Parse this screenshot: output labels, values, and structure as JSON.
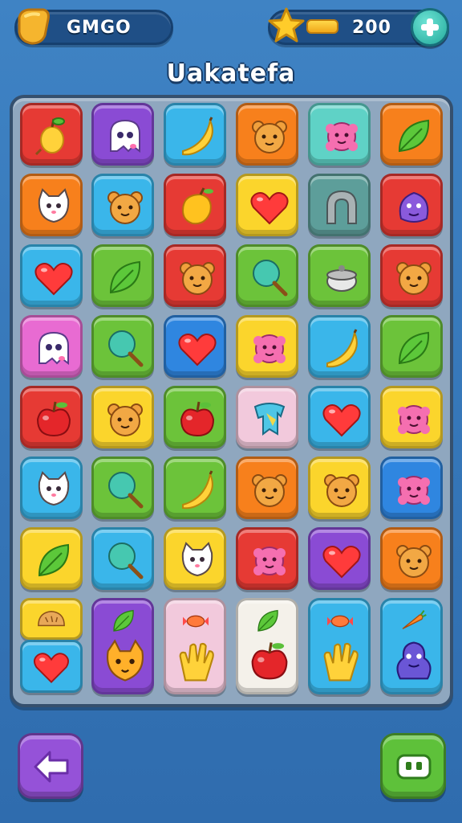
{
  "header": {
    "player_name": "GMGO",
    "coins": "200",
    "title": "Uakatefa"
  },
  "colors": {
    "red": "#e63a34",
    "purple": "#8a4bd4",
    "sky": "#3ab6ea",
    "orange": "#f7801c",
    "teal": "#5fd2c6",
    "yellow": "#fbd52c",
    "green": "#6cc33a",
    "blue": "#2f86e0",
    "pink": "#e86bd2",
    "pale": "#f2c9dc",
    "gray": "#5d9e9a"
  },
  "board": {
    "rows": [
      [
        {
          "color": "red",
          "icon": "pear"
        },
        {
          "color": "purple",
          "icon": "ghost"
        },
        {
          "color": "sky",
          "icon": "banana"
        },
        {
          "color": "orange",
          "icon": "bear"
        },
        {
          "color": "teal",
          "icon": "flower"
        },
        {
          "color": "orange",
          "icon": "leaf"
        }
      ],
      [
        {
          "color": "orange",
          "icon": "cat"
        },
        {
          "color": "sky",
          "icon": "bear"
        },
        {
          "color": "red",
          "icon": "mango"
        },
        {
          "color": "yellow",
          "icon": "heart"
        },
        {
          "color": "gray",
          "icon": "horseshoe"
        },
        {
          "color": "red",
          "icon": "blob"
        }
      ],
      [
        {
          "color": "sky",
          "icon": "heart"
        },
        {
          "color": "green",
          "icon": "leaf"
        },
        {
          "color": "red",
          "icon": "bear"
        },
        {
          "color": "green",
          "icon": "lollipop"
        },
        {
          "color": "green",
          "icon": "pot"
        },
        {
          "color": "red",
          "icon": "bear"
        }
      ],
      [
        {
          "color": "pink",
          "icon": "ghost"
        },
        {
          "color": "green",
          "icon": "lollipop"
        },
        {
          "color": "blue",
          "icon": "heart"
        },
        {
          "color": "yellow",
          "icon": "flower"
        },
        {
          "color": "sky",
          "icon": "banana"
        },
        {
          "color": "green",
          "icon": "leaf"
        }
      ],
      [
        {
          "color": "red",
          "icon": "apple"
        },
        {
          "color": "yellow",
          "icon": "bear"
        },
        {
          "color": "green",
          "icon": "apple"
        },
        {
          "color": "pale",
          "icon": "tooth"
        },
        {
          "color": "sky",
          "icon": "heart"
        },
        {
          "color": "yellow",
          "icon": "flower"
        }
      ],
      [
        {
          "color": "sky",
          "icon": "cat"
        },
        {
          "color": "green",
          "icon": "lollipop"
        },
        {
          "color": "green",
          "icon": "banana"
        },
        {
          "color": "orange",
          "icon": "bear"
        },
        {
          "color": "yellow",
          "icon": "bear"
        },
        {
          "color": "blue",
          "icon": "flower"
        }
      ],
      [
        {
          "color": "yellow",
          "icon": "leaf"
        },
        {
          "color": "sky",
          "icon": "lollipop"
        },
        {
          "color": "yellow",
          "icon": "cat"
        },
        {
          "color": "red",
          "icon": "flower"
        },
        {
          "color": "purple",
          "icon": "heart"
        },
        {
          "color": "orange",
          "icon": "bear"
        }
      ]
    ],
    "last_row": [
      {
        "top_color": "yellow",
        "top_icon": "bread",
        "color": "sky",
        "icon": "heart"
      },
      {
        "color": "purple",
        "top_icon": "leaf",
        "icon": "fox"
      },
      {
        "color": "pale",
        "top_icon": "candy",
        "icon": "hand"
      },
      {
        "color": "white",
        "top_icon": "leaf",
        "icon": "apple"
      },
      {
        "color": "sky",
        "top_icon": "candy",
        "icon": "hand"
      },
      {
        "color": "sky",
        "top_icon": "carrot",
        "icon": "monster"
      }
    ]
  },
  "buttons": {
    "back": "back-arrow-icon",
    "menu": "menu-icon"
  }
}
